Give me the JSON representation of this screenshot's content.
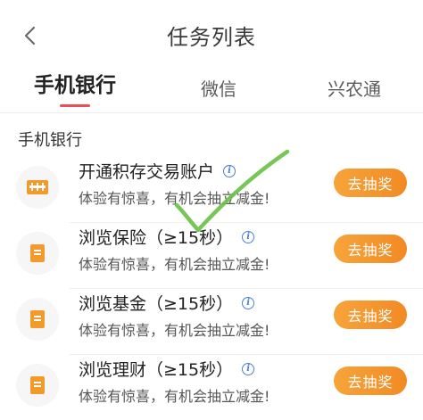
{
  "header": {
    "title": "任务列表"
  },
  "tabs": [
    {
      "label": "手机银行",
      "active": true
    },
    {
      "label": "微信",
      "active": false
    },
    {
      "label": "兴农通",
      "active": false
    }
  ],
  "section": {
    "title": "手机银行"
  },
  "tasks": [
    {
      "title": "开通积存交易账户",
      "subtitle": "体验有惊喜，有机会抽立减金!",
      "button": "去抽奖",
      "icon": "account-card-icon"
    },
    {
      "title": "浏览保险（≥15秒）",
      "subtitle": "体验有惊喜，有机会抽立减金!",
      "button": "去抽奖",
      "icon": "document-icon"
    },
    {
      "title": "浏览基金（≥15秒）",
      "subtitle": "体验有惊喜，有机会抽立减金!",
      "button": "去抽奖",
      "icon": "document-icon"
    },
    {
      "title": "浏览理财（≥15秒）",
      "subtitle": "体验有惊喜，有机会抽立减金!",
      "button": "去抽奖",
      "icon": "document-icon"
    }
  ],
  "colors": {
    "accent_orange": "#f28a24",
    "tab_indicator": "#ec4f55",
    "info_blue": "#4a7fd6",
    "check_green": "#6cc04a"
  }
}
